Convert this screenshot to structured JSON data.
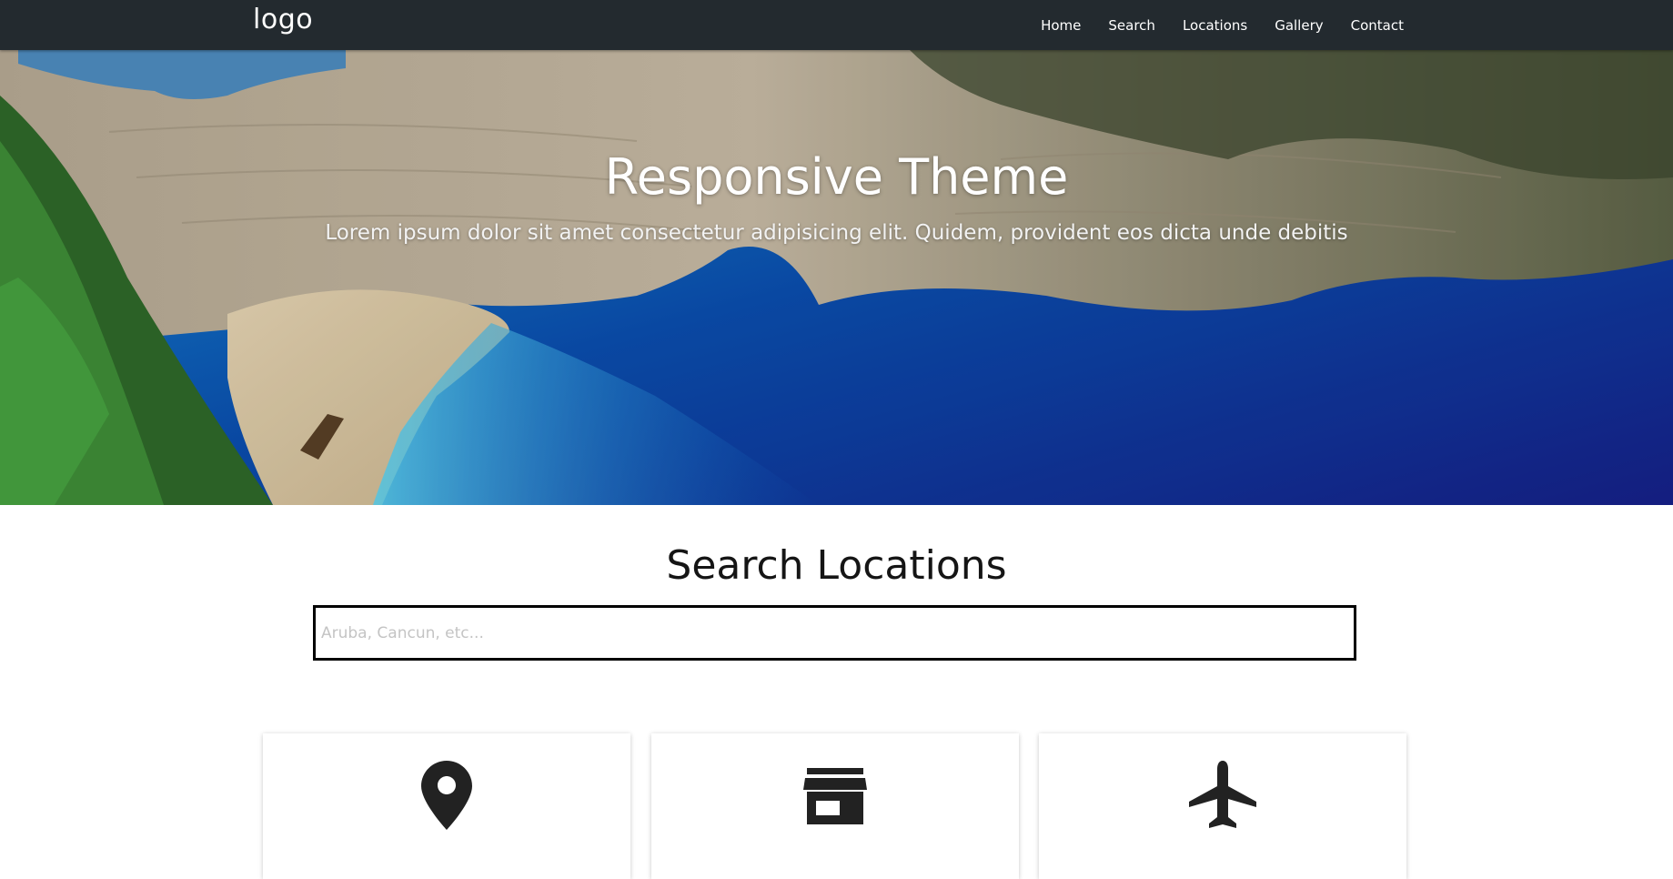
{
  "navbar": {
    "logo": "logo",
    "links": [
      "Home",
      "Search",
      "Locations",
      "Gallery",
      "Contact"
    ]
  },
  "hero": {
    "title": "Responsive Theme",
    "subtitle": "Lorem ipsum dolor sit amet consectetur adipisicing elit. Quidem, provident eos dicta unde debitis"
  },
  "search": {
    "title": "Search Locations",
    "placeholder": "Aruba, Cancun, etc..."
  },
  "cards": [
    {
      "icon": "map-marker-icon"
    },
    {
      "icon": "store-icon"
    },
    {
      "icon": "airplane-icon"
    }
  ],
  "colors": {
    "navbar_bg": "#232a2f",
    "icon": "#222222"
  }
}
